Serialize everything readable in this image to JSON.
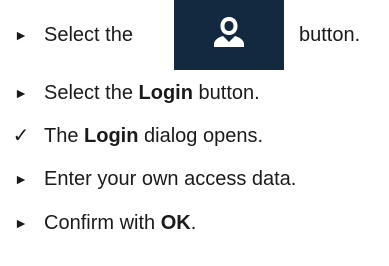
{
  "steps": [
    {
      "marker": "►",
      "text_before": "Select the",
      "icon": "user-icon",
      "text_after": "button."
    },
    {
      "marker": "►",
      "text_before": "Select the ",
      "bold": "Login",
      "text_after": " button."
    },
    {
      "marker": "✓",
      "text_before": "The ",
      "bold": "Login",
      "text_after": " dialog opens."
    },
    {
      "marker": "►",
      "text_before": "Enter your own access data.",
      "bold": "",
      "text_after": ""
    },
    {
      "marker": "►",
      "text_before": "Confirm with ",
      "bold": "OK",
      "text_after": "."
    }
  ],
  "colors": {
    "button_bg": "#12293f",
    "icon_fill": "#ffffff"
  }
}
